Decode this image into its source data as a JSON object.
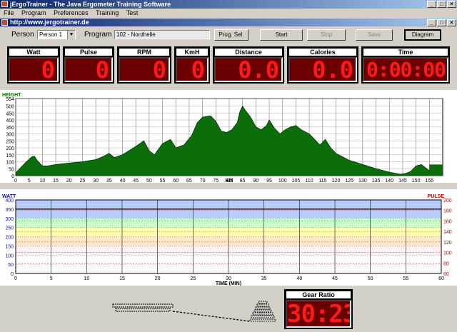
{
  "app": {
    "title": "jErgoTrainer - The Java Ergometer Training Software"
  },
  "window_buttons": {
    "minimize": "_",
    "maximize": "□",
    "close": "×"
  },
  "menu": [
    "File",
    "Program",
    "Preferences",
    "Training",
    "Test"
  ],
  "inner_window": {
    "title": "http://www.jergotrainer.de"
  },
  "controls": {
    "person_label": "Person",
    "person_value": "Person 1",
    "program_label": "Program",
    "program_value": "102 - Nordhelle",
    "prog_sel": "Prog. Sel.",
    "start": "Start",
    "stop": "Stop",
    "save": "Save",
    "diagram": "Diagram"
  },
  "meters": [
    {
      "label": "Watt",
      "value": "0"
    },
    {
      "label": "Pulse",
      "value": "0"
    },
    {
      "label": "RPM",
      "value": "0"
    },
    {
      "label": "KmH",
      "value": "0"
    },
    {
      "label": "Distance",
      "value": "0.0"
    },
    {
      "label": "Calories",
      "value": "0.0"
    },
    {
      "label": "Time",
      "value": "0:00:00"
    }
  ],
  "gear": {
    "label": "Gear Ratio",
    "value": "30:23"
  },
  "colors": {
    "led_bg": "#6a0000",
    "led_fg": "#ff1a1a",
    "height_fill": "#0b6e0b",
    "watt_axis": "#1010a0",
    "pulse_axis": "#c00000"
  },
  "chart_data": [
    {
      "type": "area",
      "title": "HEIGHT",
      "xlabel": "KM",
      "x_ticks": [
        0,
        5,
        10,
        15,
        20,
        25,
        30,
        35,
        40,
        45,
        50,
        55,
        60,
        65,
        70,
        75,
        80,
        85,
        90,
        95,
        100,
        105,
        110,
        115,
        120,
        125,
        130,
        135,
        140,
        145,
        150,
        155
      ],
      "y_ticks": [
        0,
        50,
        100,
        150,
        200,
        250,
        300,
        350,
        400,
        450,
        500,
        554
      ],
      "ylim": [
        0,
        554
      ],
      "xlim": [
        0,
        160
      ],
      "grid": true,
      "x": [
        0,
        2,
        4,
        6,
        7,
        8,
        10,
        12,
        15,
        20,
        25,
        30,
        33,
        35,
        37,
        40,
        45,
        48,
        50,
        52,
        55,
        58,
        60,
        63,
        66,
        68,
        70,
        73,
        75,
        77,
        79,
        81,
        83,
        84,
        85,
        86,
        88,
        90,
        92,
        94,
        95,
        97,
        99,
        101,
        103,
        105,
        107,
        110,
        112,
        114,
        116,
        118,
        120,
        125,
        130,
        135,
        140,
        144,
        146,
        148,
        150,
        152,
        154,
        156,
        158,
        160
      ],
      "y": [
        20,
        60,
        100,
        135,
        140,
        110,
        70,
        70,
        80,
        90,
        100,
        115,
        140,
        160,
        130,
        150,
        210,
        250,
        180,
        150,
        230,
        260,
        200,
        220,
        290,
        380,
        420,
        430,
        390,
        320,
        310,
        330,
        380,
        460,
        500,
        470,
        420,
        350,
        330,
        360,
        400,
        340,
        300,
        330,
        350,
        360,
        330,
        300,
        260,
        220,
        260,
        200,
        160,
        110,
        80,
        50,
        25,
        10,
        15,
        30,
        70,
        80,
        50,
        20,
        0,
        0
      ],
      "bar_end": {
        "x": [
          155,
          160
        ],
        "y": 80
      }
    },
    {
      "type": "line",
      "title": "WATT",
      "y2label": "PULSE",
      "xlabel": "TIME (MIN)",
      "x_ticks": [
        0,
        5,
        10,
        15,
        20,
        25,
        30,
        35,
        40,
        45,
        50,
        55,
        60
      ],
      "y_ticks": [
        0,
        50,
        100,
        150,
        200,
        250,
        300,
        350,
        400
      ],
      "y2_ticks": [
        60,
        80,
        100,
        120,
        140,
        160,
        180,
        200
      ],
      "ylim": [
        0,
        400
      ],
      "y2lim": [
        60,
        200
      ],
      "xlim": [
        0,
        60
      ],
      "zones": [
        {
          "from": 300,
          "to": 400,
          "color": "#b8ccff"
        },
        {
          "from": 250,
          "to": 300,
          "color": "#c8ffc8"
        },
        {
          "from": 200,
          "to": 250,
          "color": "#ffffb0"
        },
        {
          "from": 150,
          "to": 200,
          "color": "#ffe8c8"
        },
        {
          "from": 100,
          "to": 150,
          "color": "#ffeef4"
        },
        {
          "from": 0,
          "to": 100,
          "color": "#fafafa"
        }
      ],
      "watt_line": 350,
      "series": []
    }
  ]
}
